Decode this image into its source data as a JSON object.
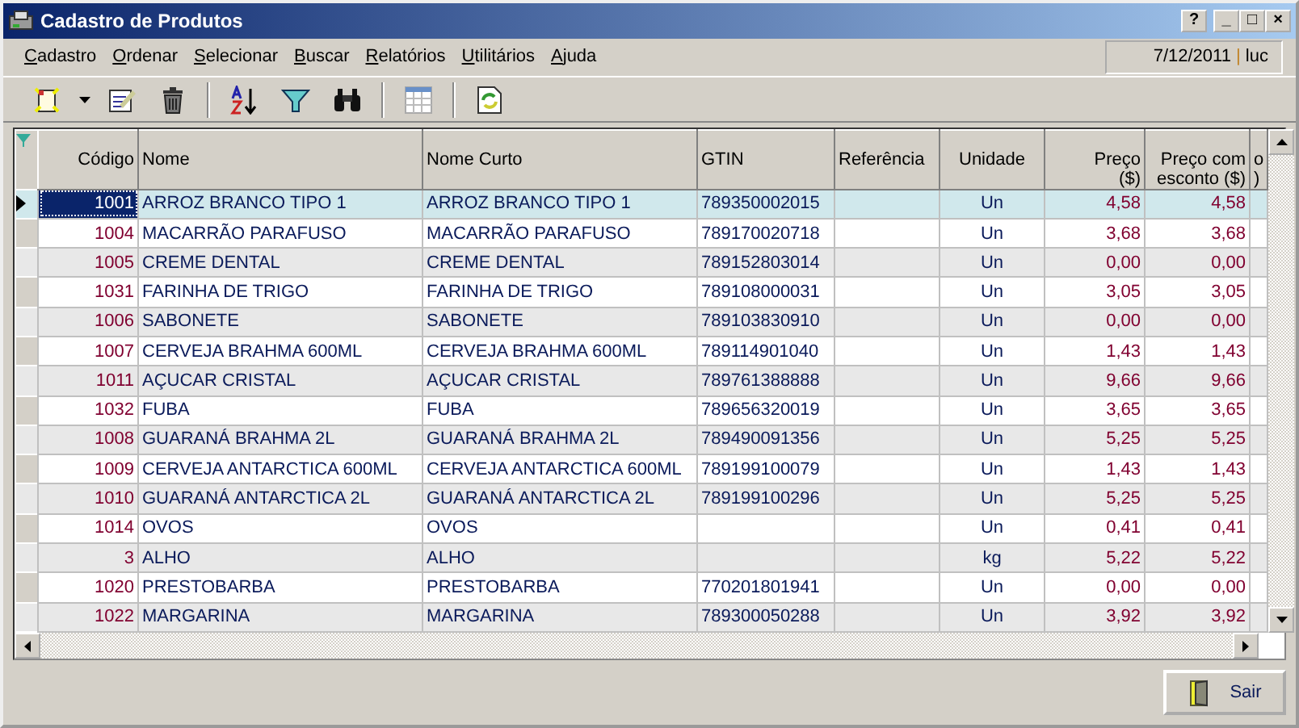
{
  "window": {
    "title": "Cadastro de Produtos",
    "buttons": [
      "?",
      "_",
      "□",
      "×"
    ]
  },
  "menu": [
    "Cadastro",
    "Ordenar",
    "Selecionar",
    "Buscar",
    "Relatórios",
    "Utilitários",
    "Ajuda"
  ],
  "session": {
    "date": "7/12/2011",
    "separator": "|",
    "user": "luc"
  },
  "toolbar": [
    {
      "kind": "new"
    },
    {
      "kind": "dropdown"
    },
    {
      "kind": "edit"
    },
    {
      "kind": "delete"
    },
    {
      "kind": "sep"
    },
    {
      "kind": "sort"
    },
    {
      "kind": "filter"
    },
    {
      "kind": "find"
    },
    {
      "kind": "sep"
    },
    {
      "kind": "grid"
    },
    {
      "kind": "sep"
    },
    {
      "kind": "refresh"
    }
  ],
  "table": {
    "columns": [
      {
        "lines": [
          "Código"
        ]
      },
      {
        "lines": [
          "Nome"
        ]
      },
      {
        "lines": [
          "Nome Curto"
        ]
      },
      {
        "lines": [
          "GTIN"
        ]
      },
      {
        "lines": [
          "Referência"
        ]
      },
      {
        "lines": [
          "Unidade"
        ]
      },
      {
        "lines": [
          "Preço",
          "($)"
        ]
      },
      {
        "lines": [
          "Preço com",
          "esconto ($)"
        ]
      },
      {
        "lines": [
          "o",
          ")"
        ]
      }
    ],
    "rows": [
      {
        "selected": true,
        "cells": [
          "1001",
          "ARROZ BRANCO TIPO 1",
          "ARROZ BRANCO TIPO 1",
          "789350002015",
          "",
          "Un",
          "4,58",
          "4,58"
        ]
      },
      {
        "selected": false,
        "cells": [
          "1004",
          "MACARRÃO PARAFUSO",
          "MACARRÃO PARAFUSO",
          "789170020718",
          "",
          "Un",
          "3,68",
          "3,68"
        ]
      },
      {
        "selected": false,
        "cells": [
          "1005",
          "CREME DENTAL",
          "CREME DENTAL",
          "789152803014",
          "",
          "Un",
          "0,00",
          "0,00"
        ]
      },
      {
        "selected": false,
        "cells": [
          "1031",
          "FARINHA DE TRIGO",
          "FARINHA DE TRIGO",
          "789108000031",
          "",
          "Un",
          "3,05",
          "3,05"
        ]
      },
      {
        "selected": false,
        "cells": [
          "1006",
          "SABONETE",
          "SABONETE",
          "789103830910",
          "",
          "Un",
          "0,00",
          "0,00"
        ]
      },
      {
        "selected": false,
        "cells": [
          "1007",
          "CERVEJA BRAHMA 600ML",
          "CERVEJA BRAHMA 600ML",
          "789114901040",
          "",
          "Un",
          "1,43",
          "1,43"
        ]
      },
      {
        "selected": false,
        "cells": [
          "1011",
          "AÇUCAR CRISTAL",
          "AÇUCAR CRISTAL",
          "789761388888",
          "",
          "Un",
          "9,66",
          "9,66"
        ]
      },
      {
        "selected": false,
        "cells": [
          "1032",
          "FUBA",
          "FUBA",
          "789656320019",
          "",
          "Un",
          "3,65",
          "3,65"
        ]
      },
      {
        "selected": false,
        "cells": [
          "1008",
          "GUARANÁ BRAHMA 2L",
          "GUARANÁ BRAHMA 2L",
          "789490091356",
          "",
          "Un",
          "5,25",
          "5,25"
        ]
      },
      {
        "selected": false,
        "cells": [
          "1009",
          "CERVEJA ANTARCTICA 600ML",
          "CERVEJA ANTARCTICA 600ML",
          "789199100079",
          "",
          "Un",
          "1,43",
          "1,43"
        ]
      },
      {
        "selected": false,
        "cells": [
          "1010",
          "GUARANÁ ANTARCTICA 2L",
          "GUARANÁ ANTARCTICA 2L",
          "789199100296",
          "",
          "Un",
          "5,25",
          "5,25"
        ]
      },
      {
        "selected": false,
        "cells": [
          "1014",
          "OVOS",
          "OVOS",
          "",
          "",
          "Un",
          "0,41",
          "0,41"
        ]
      },
      {
        "selected": false,
        "cells": [
          "3",
          "ALHO",
          "ALHO",
          "",
          "",
          "kg",
          "5,22",
          "5,22"
        ]
      },
      {
        "selected": false,
        "cells": [
          "1020",
          "PRESTOBARBA",
          "PRESTOBARBA",
          "770201801941",
          "",
          "Un",
          "0,00",
          "0,00"
        ]
      },
      {
        "selected": false,
        "cells": [
          "1022",
          "MARGARINA",
          "MARGARINA",
          "789300050288",
          "",
          "Un",
          "3,92",
          "3,92"
        ]
      }
    ]
  },
  "footer": {
    "button": "Sair"
  }
}
